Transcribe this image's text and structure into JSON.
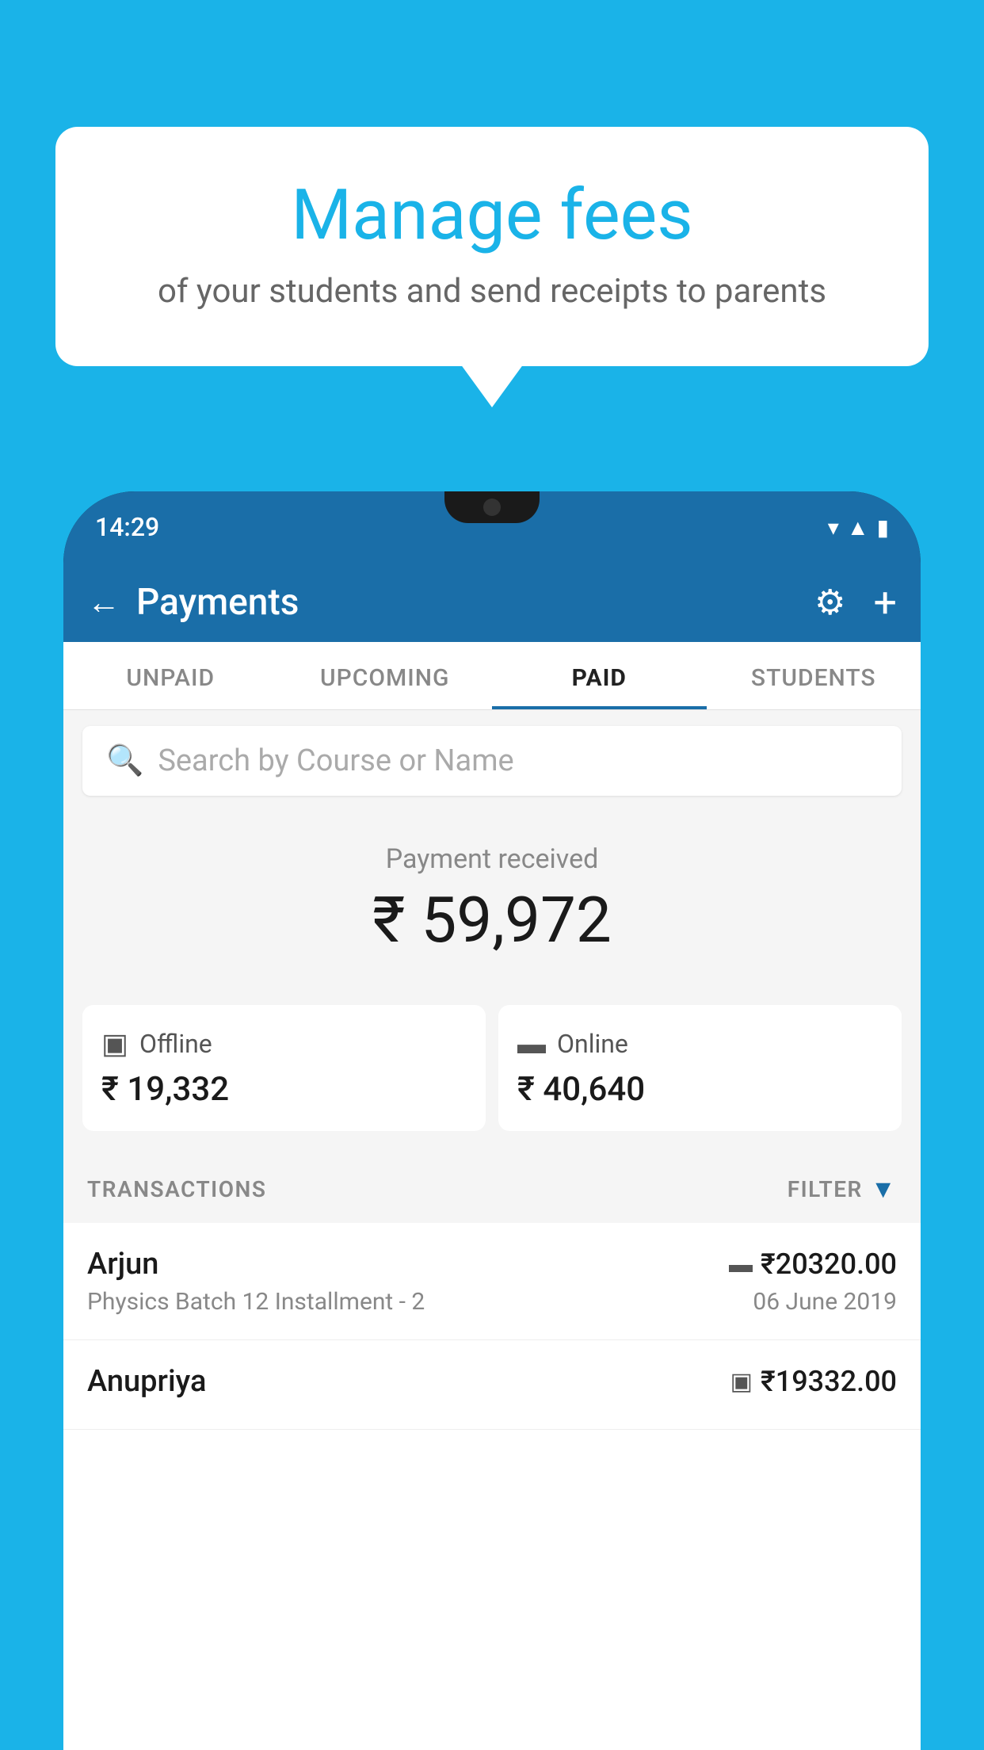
{
  "background_color": "#1ab3e8",
  "bubble": {
    "title": "Manage fees",
    "subtitle": "of your students and send receipts to parents"
  },
  "phone": {
    "status": {
      "time": "14:29"
    },
    "header": {
      "title": "Payments",
      "back_label": "←",
      "plus_label": "+"
    },
    "tabs": [
      {
        "label": "UNPAID",
        "active": false
      },
      {
        "label": "UPCOMING",
        "active": false
      },
      {
        "label": "PAID",
        "active": true
      },
      {
        "label": "STUDENTS",
        "active": false
      }
    ],
    "search": {
      "placeholder": "Search by Course or Name"
    },
    "payment_received": {
      "label": "Payment received",
      "amount": "₹ 59,972"
    },
    "cards": [
      {
        "type": "Offline",
        "amount": "₹ 19,332"
      },
      {
        "type": "Online",
        "amount": "₹ 40,640"
      }
    ],
    "transactions_label": "TRANSACTIONS",
    "filter_label": "FILTER",
    "transactions": [
      {
        "name": "Arjun",
        "amount": "₹20320.00",
        "payment_type": "online",
        "course": "Physics Batch 12 Installment - 2",
        "date": "06 June 2019"
      },
      {
        "name": "Anupriya",
        "amount": "₹19332.00",
        "payment_type": "offline",
        "course": "",
        "date": ""
      }
    ]
  }
}
